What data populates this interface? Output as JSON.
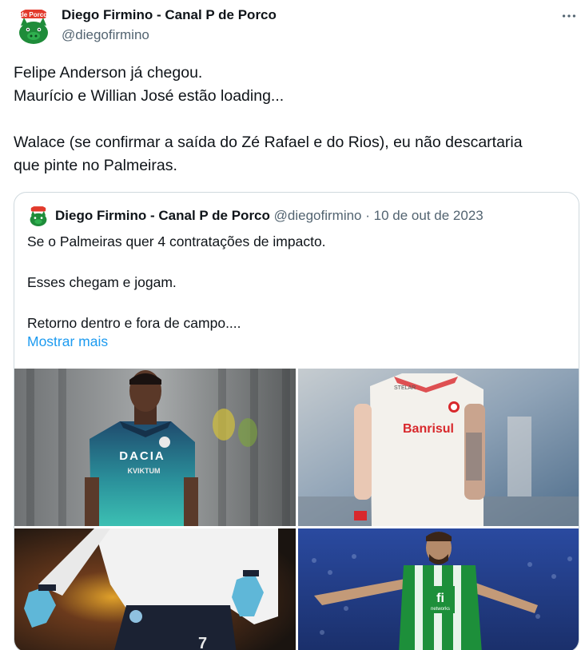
{
  "author": {
    "name": "Diego Firmino - Canal P de Porco",
    "handle": "@diegofirmino",
    "avatar_icon": "porco-mascot-logo",
    "avatar_logo_text": "de Porco"
  },
  "more_icon": "more-horizontal-icon",
  "tweet": {
    "lines": [
      "Felipe Anderson já chegou.",
      "Maurício e Willian José estão loading...",
      "",
      "Walace (se confirmar a saída do Zé Rafael e do Rios), eu não descartaria",
      "que pinte no Palmeiras."
    ]
  },
  "quote": {
    "name": "Diego Firmino - Canal P de Porco",
    "handle": "@diegofirmino",
    "separator": "·",
    "date": "10 de out de 2023",
    "lines": [
      "Se o Palmeiras quer 4 contratações de impacto.",
      "",
      "Esses chegam e jogam.",
      "",
      "Retorno dentro e fora de campo...."
    ],
    "show_more": "Mostrar mais"
  },
  "media": {
    "photo1": {
      "shirt_text": "DACIA",
      "shirt_sub": "KVIKTUM",
      "colors": {
        "shirt": "#1f4b6e",
        "teal": "#33b8b0",
        "bg": "#8f9396"
      }
    },
    "photo2": {
      "shirt_text": "Banrisul",
      "shirt_top": "STELAR",
      "colors": {
        "shirt": "#f3f1ec",
        "red": "#d8282c",
        "bg": "#9fb2c4"
      }
    },
    "photo3": {
      "shirt_number": "7",
      "colors": {
        "shirt": "#f2f2f2",
        "glove": "#5fb7d8",
        "shorts": "#1b2233",
        "bg": "#3a2a1f"
      }
    },
    "photo4": {
      "shirt_text": "fi",
      "shirt_sub": "networks",
      "colors": {
        "shirt": "#1d8f3a",
        "stripe": "#ffffff",
        "bg": "#2a4aa0"
      }
    }
  },
  "colors": {
    "text": "#0f1419",
    "secondary": "#536471",
    "link": "#1d9bf0",
    "border": "#cfd9de",
    "brand_green": "#1f8c3a"
  }
}
